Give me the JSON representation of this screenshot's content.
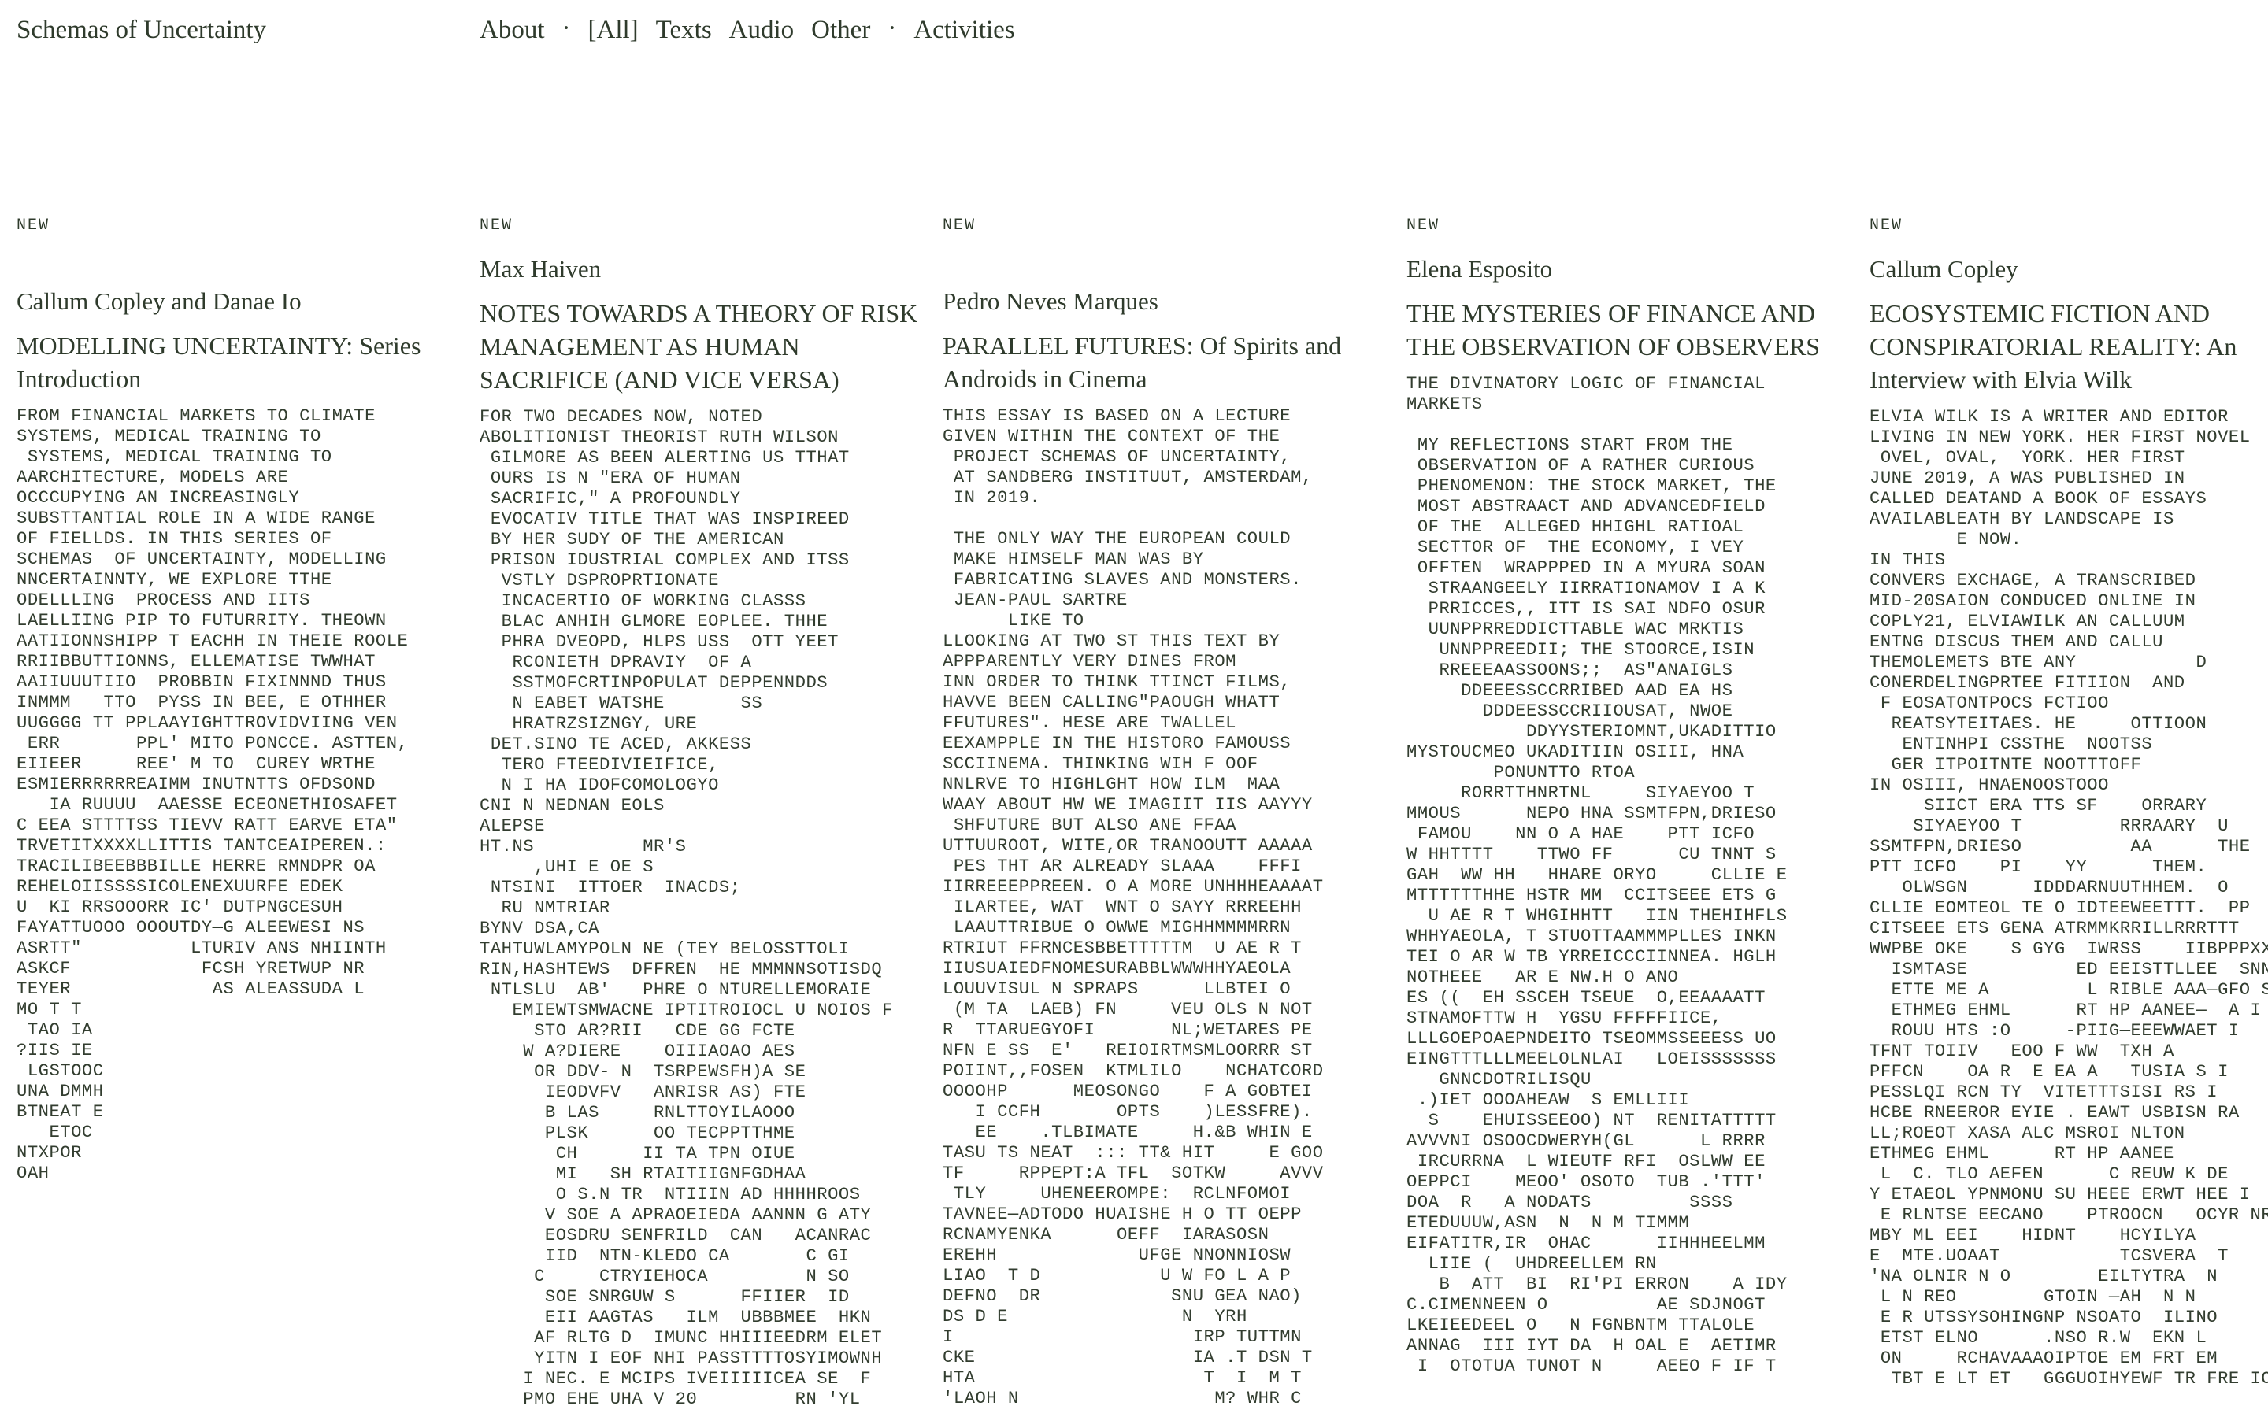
{
  "site": {
    "title": "Schemas of Uncertainty"
  },
  "nav": {
    "items": [
      "About",
      "·",
      "[All]",
      "Texts",
      "Audio",
      "Other",
      "·",
      "Activities"
    ]
  },
  "columns": [
    {
      "badge": "NEW",
      "author": "Callum Copley and Danae Io",
      "title": "MODELLING UNCERTAINTY: Series Introduction",
      "excerpt": "FROM FINANCIAL MARKETS TO CLIMATE\nSYSTEMS, MEDICAL TRAINING TO\n SYSTEMS, MEDICAL TRAINING TO\nAARCHITECTURE, MODELS ARE\nOCCCUPYING AN INCREASINGLY\nSUBSTTANTIAL ROLE IN A WIDE RANGE\nOF FIELLDS. IN THIS SERIES OF\nSCHEMAS  OF UNCERTAINTY, MODELLING\nNNCERTAINNTY, WE EXPLORE TTHE\nODELLLING  PROCESS AND IITS\nLAELLIING PIP TO FUTURRITY. THEOWN\nAATIIONNSHIPP T EACHH IN THEIE ROOLE\nRRIIBBUTTIONNS, ELLEMATISE TWWHAT\nAAIIUUUTIIO  PROBBIN FIXINNND THUS\nINMMM   TTO  PYSS IN BEE, E OTHHER\nUUGGGG TT PPLAAYIGHTTROVIDVIING VEN\n ERR       PPL' MITO PONCCE. ASTTEN,\nEIIEER     REE' M TO  CUREY WRTHE\nESMIERRRRRREAIMM INUTNTTS OFDSOND\n   IA RUUUU  AAESSE ECEONETHIOSAFET\nC EEA STTTTSS TIEVV RATT EARVE ETA\"\nTRVETITXXXXLLITTIS TANTCEAIPEREN.:\nTRACILIBEEBBBILLE HERRE RMNDPR OA\nREHELOIISSSSICOLENEXUURFE EDEK\nU  KI RRSOOORR IC' DUTPNGCESUH\nFAYATTUOOO OOOUTDY—G ALEEWESI NS\nASRTT\"          LTURIV ANS NHIINTH\nASKCF            FCSH YRETWUP NR\nTEYER             AS ALEASSUDA L\nMO T T\n TAO IA\n?IIS IE\n LGSTOOC\nUNA DMMH\nBTNEAT E\n   ETOC\nNTXPOR\nOAH"
    },
    {
      "badge": "NEW",
      "author": "Max Haiven",
      "title": "NOTES TOWARDS A THEORY OF RISK MANAGEMENT AS HUMAN SACRIFICE (AND VICE VERSA)",
      "excerpt": "FOR TWO DECADES NOW, NOTED\nABOLITIONIST THEORIST RUTH WILSON\n GILMORE AS BEEN ALERTING US TTHAT\n OURS IS N \"ERA OF HUMAN\n SACRIFIC,\" A PROFOUNDLY\n EVOCATIV TITLE THAT WAS INSPIREED\n BY HER SUDY OF THE AMERICAN\n PRISON IDUSTRIAL COMPLEX AND ITSS\n  VSTLY DSPROPRTIONATE\n  INCACERTIO OF WORKING CLASSS\n  BLAC ANHIH GLMORE EOPLEE. THHE\n  PHRA DVEOPD, HLPS USS  OTT YEET\n   RCONIETH DPRAVIY  OF A\n   SSTMOFCRTINPOPULAT DEPPENNDDS\n   N EABET WATSHE       SS\n   HRATRZSIZNGY, URE\n DET.SINO TE ACED, AKKESS\n  TERO FTEEDIVIEIFICE,\n  N I HA IDOFCOMOLOGYO\nCNI N NEDNAN EOLS\nALEPSE\nHT.NS          MR'S\n     ,UHI E OE S\n NTSINI  ITTOER  INACDS;\n  RU NMTRIAR\nBYNV DSA,CA\nTAHTUWLAMYPOLN NE (TEY BELOSSTTOLI\nRIN,HASHTEWS  DFFREN  HE MMMNNSOTISDQ\n NTLSLU  AB'   PHRE O NTURELLEMORAIE\n   EMIEWTSMWACNE IPTITROIOCL U NOIOS F\n     STO AR?RII   CDE GG FCTE\n    W A?DIERE    OIIIAOAO AES\n     OR DDV- N  TSRPEWSFH)A SE\n      IEODVFV   ANRISR AS) FTE\n      B LAS     RNLTTOYILAOOO\n      PLSK      OO TECPPTTHME\n       CH      II TA TPN OIUE\n       MI   SH RTAITIIGNFGDHAA\n       O S.N TR  NTIIIN AD HHHHROOS\n      V SOE A APRAOEIEDA AANNN G ATY\n      EOSDRU SENFRILD  CAN   ACANRAC\n      IID  NTN-KLEDO CA       C GI\n     C     CTRYIEHOCA         N SO\n      SOE SNRGUW S      FFIIER  ID\n      EII AAGTAS   ILM  UBBBMEE  HKN\n     AF RLTG D  IMUNC HHIIIEEDRM ELET\n     YITN I EOF NHI PASSTTTTOSYIMOWNH\n    I NEC. E MCIPS IVEIIIIICEA SE  F\n    PMO EHE UHA V 20         RN 'YL"
    },
    {
      "badge": "NEW",
      "author": "Pedro Neves Marques",
      "title": "PARALLEL FUTURES: Of Spirits and Androids in Cinema",
      "excerpt": "THIS ESSAY IS BASED ON A LECTURE\nGIVEN WITHIN THE CONTEXT OF THE\n PROJECT SCHEMAS OF UNCERTAINTY,\n AT SANDBERG INSTITUUT, AMSTERDAM,\n IN 2019.\n\n THE ONLY WAY THE EUROPEAN COULD\n MAKE HIMSELF MAN WAS BY\n FABRICATING SLAVES AND MONSTERS.\n JEAN-PAUL SARTRE\n      LIKE TO\nLLOOKING AT TWO ST THIS TEXT BY\nAPPPARENTLY VERY DINES FROM\nINN ORDER TO THINK TTINCT FILMS,\nHAVVE BEEN CALLING\"PAOUGH WHATT\nFFUTURES\". HESE ARE TWALLEL\nEEXAMPPLE IN THE HISTORO FAMOUSS\nSCCIINEMA. THINKING WIH F OOF\nNNLRVE TO HIGHLGHT HOW ILM  MAA\nWAAY ABOUT HW WE IMAGIIT IIS AAYYY\n SHFUTURE BUT ALSO ANE FFAA\nUTTUUROOT, WITE,OR TRANOOUTT AAAAA\n PES THT AR ALREADY SLAAA    FFFI\nIIRREEEPPREEN. O A MORE UNHHHEAAAAT\n ILARTEE, WAT  WNT O SAYY RRREEHH\n LAAUTTRIBUE O OWWE MIGHHMMMMRRN\nRTRIUT FFRNCESBBETTTTTM  U AE R T\nIIUSUAIEDFNOMESURABBLWWWHHYAEOLA\nLOUUVISUL N SPRAPS      LLBTEI O\n (M TA  LAEB) FN     VEU OLS N NOT\nR  TTARUEGYOFI       NL;WETARES PE\nNFN E SS  E'   REIOIRTMSMLOORRR ST\nPOIINT,,FOSEN  KTMLILO    NCHATCORD\nOOOOHP      MEOSONGO    F A GOBTEI\n   I CCFH       OPTS    )LESSFRE).\n   EE    .TLBIMATE     H.&B WHIN E\nTASU TS NEAT  ::: TT& HIT     E GOO\nTF     RPPEPT:A TFL  SOTKW     AVVV\n TLY     UHENEEROMPE:  RCLNFOMOI\nTAVNEE—ADTODO HUAISHE H O TT OEPP\nRCNAMYENKA      OEFF  IARASOSN\nEREHH             UFGE NNONNIOSW\nLIAO  T D           U W FO L A P\nDEFNO  DR            SNU GEA NAO)\nDS D E                N  YRH\nI                      IRP TUTTMN\nCKE                    IA .T DSN T\nHTA                     T  I  M T\n'LAOH N                  M? WHR C"
    },
    {
      "badge": "NEW",
      "author": "Elena Esposito",
      "title": "THE MYSTERIES OF FINANCE AND THE OBSERVATION OF OBSERVERS",
      "excerpt": "THE DIVINATORY LOGIC OF FINANCIAL\nMARKETS\n\n MY REFLECTIONS START FROM THE\n OBSERVATION OF A RATHER CURIOUS\n PHENOMENON: THE STOCK MARKET, THE\n MOST ABSTRAACT AND ADVANCEDFIELD\n OF THE  ALLEGED HHIGHL RATIOAL\n SECTTOR OF  THE ECONOMY, I VEY\n OFFTEN  WRAPPPED IN A MYURA SOAN\n  STRAANGEELY IIRRATIONAMOV I A K\n  PRRICCES,, ITT IS SAI NDFO OSUR\n  UUNPPRREDDICTTABLE WAC MRKTIS\n   UNNPPREEDII; THE STOORCE,ISIN\n   RREEEAASSOONS;;  AS\"ANAIGLS\n     DDEEESSCCRRIBED AAD EA HS\n       DDDEESSCCRIIOUSAT, NWOE\n           DDYYSTERIOMNT,UKADITTIO\nMYSTOUCMEO UKADITIIN OSIII, HNA\n        PONUNTTO RTOA\n     RORRTTHNRTNL     SIYAEYOO T\nMMOUS      NEPO HNA SSMTFPN,DRIESO\n FAMOU    NN O A HAE    PTT ICFO\nW HHTTTT    TTWO FF      CU TNNT S\nGAH  WW HH   HHARE ORYO     CLLIE E\nMTTTTTTHHE HSTR MM  CCITSEEE ETS G\n  U AE R T WHGIHHTT   IIN THEHIHFLS\nWHHYAEOLA, T STUOTTAAMMMPLLES INKN\nTEI O AR W TB YRREICCCIINNEA. HGLH\nNOTHEEE   AR E NW.H O ANO\nES ((  EH SSCEH TSEUE  O,EEAAAATT\nSTNAMOFTTW H  YGSU FFFFFIICE,\nLLLGOEPOAEPNDEITO TSEOMMSSEEESS UO\nEINGTTTLLLMEELOLNLAI   LOEISSSSSSS\n   GNNCDOTRILISQU\n .)IET OOOAHEAW  S EMLLIII\n  S    EHUISSEEOO) NT  RENITATTTTT\nAVVVNI OSOOCDWERYH(GL      L RRRR\n IRCURRNA  L WIEUTF RFI  OSLWW EE\nOEPPCI    MEOO' OSOTO  TUB .'TTT'\nDOA  R   A NODATS         SSSS\nETEDUUUW,ASN  N  N M TIMMM\nEIFATITR,IR  OHAC      IIHHHEELMM\n  LIIE (  UHDREELLEM RN\n   B  ATT  BI  RI'PI ERRON    A IDY\nC.CIMENNEEN O          AE SDJNOGT\nLKEIEEDEEL O   N FGNBNTM TTALOLE\nANNAG  III IYT DA  H OAL E  AETIMR\n I  OTOTUA TUNOT N     AEEO F IF T"
    },
    {
      "badge": "NEW",
      "author": "Callum Copley",
      "title": "ECOSYSTEMIC FICTION AND CONSPIRATORIAL REALITY: An Interview with Elvia Wilk",
      "excerpt": "ELVIA WILK IS A WRITER AND EDITOR\nLIVING IN NEW YORK. HER FIRST NOVEL\n OVEL, OVAL,  YORK. HER FIRST\nJUNE 2019, A WAS PUBLISHED IN\nCALLED DEATAND A BOOK OF ESSAYS\nAVAILABLEATH BY LANDSCAPE IS\n        E NOW.\nIN THIS\nCONVERS EXCHAGE, A TRANSCRIBED\nMID-20SAION CONDUCED ONLINE IN\nCOPLY21, ELVIAWILK AN CALLUUM\nENTNG DISCUS THEM AND CALLU\nTHEMOLEMETS BTE ANY           D\nCONERDELINGPRTEE FITIION  AND\n F EOSATONTPOCS FCTIOO\n  REATSYTEITAES. HE     OTTIOON\n   ENTINHPI CSSTHE  NOOTSS\n  GER ITPOITNTE NOOTTTOFF\nIN OSIII, HNAENOOSTOOO\n     SIICT ERA TTS SF    ORRARY\n    SIYAEYOO T         RRRAARY  U\nSSMTFPN,DRIESO          AA      THE\nPTT ICFO    PI    YY      THEM.\n   OLWSGN      IDDDARNUUTHHEM.  O\nCLLIE EOMTEOL TE O IDTEEWEETTT.  PP\nCITSEEE ETS GENA ATRMMKRRILLRRRTTT\nWWPBE OKE    S GYG  IWRSS    IIBPPPXXOIR\n  ISMTASE          ED EEISTTLLEE  SNN ,ET\n  ETTE ME A         L RIBLE AAA—GFO S M\n  ETHMEG EHML      RT HP AANEE—  A I\n  ROUU HTS :O     -PIIG—EEEWWAET I\nTFNT TOIIV   EOO F WW  TXH A\nPFFCN    OA R  E EA A   TUSIA S I\nPESSLQI RCN TY  VITETTTSISI RS I\nHCBE RNEEROR EYIE . EAWT USBISN RA\nLL;ROEOT XASA ALC MSROI NLTON\nETHMEG EHML      RT HP AANEE\n L  C. TLO AEFEN      C REUW K DE\nY ETAEOL YPNMONU SU HEEE ERWT HEE I\n E RLNTSE EECANO    PTROOCN   OCYR NR\nMBY ML EEI    HIDNT    HCYILYA\nE  MTE.UOAAT           TCSVERA  T\n'NA OLNIR N O        EILTYTRA  N\n L N REO        GTOIN —AH  N N\n E R UTSSYSOHINGNP NSOATO  ILINO\n ETST ELNO      .NSO R.W  EKN L\n ON     RCHAVAAAOIPTOE EM FRT EM\n  TBT E LT ET   GGGUOIHYEWF TR FRE IO"
    }
  ]
}
